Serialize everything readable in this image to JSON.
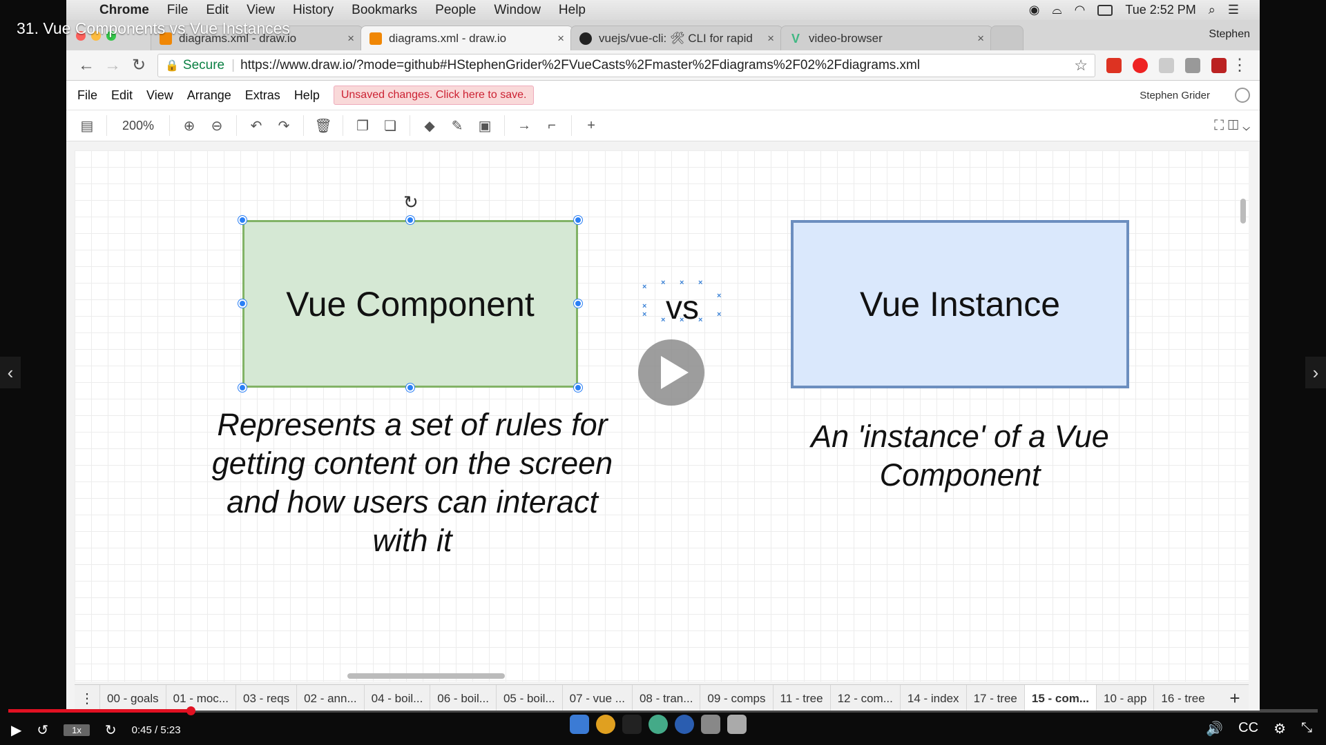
{
  "video": {
    "title": "31. Vue Components vs Vue Instances",
    "time": "0:45 / 5:23",
    "speed": "1x",
    "progress_fraction": 0.139
  },
  "mac_menubar": {
    "app": "Chrome",
    "items": [
      "File",
      "Edit",
      "View",
      "History",
      "Bookmarks",
      "People",
      "Window",
      "Help"
    ],
    "clock": "Tue 2:52 PM"
  },
  "browser": {
    "profile": "Stephen",
    "tabs": [
      {
        "label": "diagrams.xml - draw.io",
        "icon": "drawio-icon"
      },
      {
        "label": "diagrams.xml - draw.io",
        "icon": "drawio-icon"
      },
      {
        "label": "vuejs/vue-cli: 🛠 CLI for rapid",
        "icon": "github-icon"
      },
      {
        "label": "video-browser",
        "icon": "vue-icon"
      }
    ],
    "secure_label": "Secure",
    "url": "https://www.draw.io/?mode=github#HStephenGrider%2FVueCasts%2Fmaster%2Fdiagrams%2F02%2Fdiagrams.xml"
  },
  "drawio": {
    "menu": [
      "File",
      "Edit",
      "View",
      "Arrange",
      "Extras",
      "Help"
    ],
    "unsaved": "Unsaved changes. Click here to save.",
    "user": "Stephen Grider",
    "zoom": "200%",
    "shapes": {
      "component": "Vue Component",
      "vs": "vs",
      "instance": "Vue Instance"
    },
    "desc_component": "Represents a set of rules for getting content on the screen and how users can interact with it",
    "desc_instance": "An 'instance' of a Vue Component",
    "pages": [
      "00 - goals",
      "01 - moc...",
      "03 - reqs",
      "02 - ann...",
      "04 - boil...",
      "06 - boil...",
      "05 - boil...",
      "07 - vue ...",
      "08 - tran...",
      "09 - comps",
      "11 - tree",
      "12 - com...",
      "14 - index",
      "17 - tree",
      "15 - com...",
      "10 - app",
      "16 - tree"
    ],
    "active_page": "15 - com..."
  },
  "colors": {
    "component_fill": "#d5e8d4",
    "component_stroke": "#82b366",
    "instance_fill": "#dae8fc",
    "instance_stroke": "#6c8ebf",
    "progress": "#e11122"
  }
}
